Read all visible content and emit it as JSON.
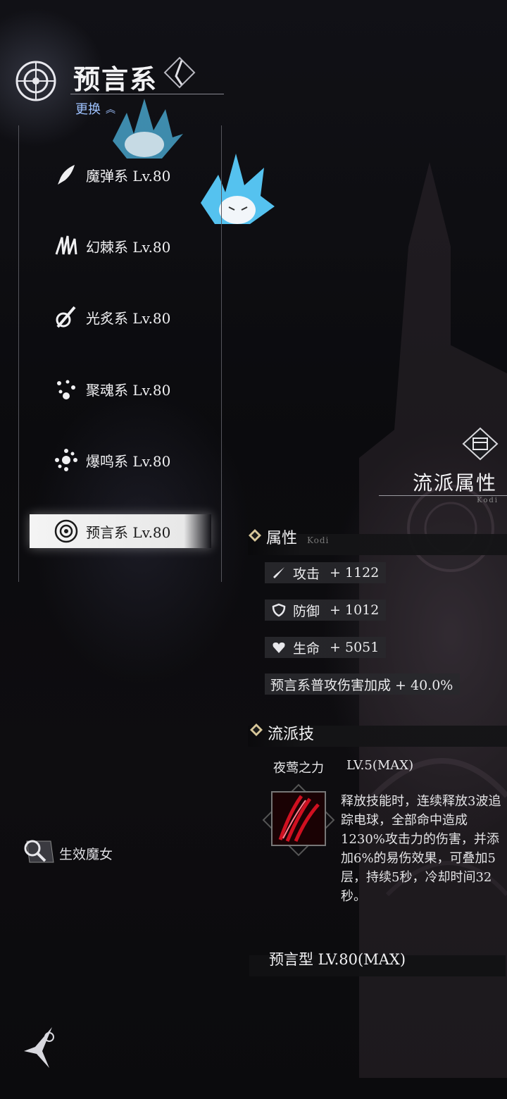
{
  "header": {
    "title": "预言系",
    "change_label": "更换",
    "change_icon": "double-chevron-up-icon"
  },
  "school_list": [
    {
      "label": "魔弹系 Lv.80",
      "icon": "magic-bullet-icon",
      "selected": false
    },
    {
      "label": "幻棘系 Lv.80",
      "icon": "thorn-icon",
      "selected": false
    },
    {
      "label": "光炙系 Lv.80",
      "icon": "light-blade-icon",
      "selected": false
    },
    {
      "label": "聚魂系 Lv.80",
      "icon": "soul-orbs-icon",
      "selected": false
    },
    {
      "label": "爆鸣系 Lv.80",
      "icon": "burst-orbs-icon",
      "selected": false
    },
    {
      "label": "预言系 Lv.80",
      "icon": "prophecy-sigil-icon",
      "selected": true
    }
  ],
  "panel": {
    "title": "流派属性",
    "subtitle": "Kodi",
    "attributes_header": "属性",
    "attributes_sub": "Kodi",
    "stats": [
      {
        "icon": "sword-icon",
        "name": "攻击",
        "value": "+ 1122"
      },
      {
        "icon": "shield-icon",
        "name": "防御",
        "value": "+ 1012"
      },
      {
        "icon": "heart-icon",
        "name": "生命",
        "value": "+ 5051"
      }
    ],
    "bonus": "预言系普攻伤害加成 + 40.0%",
    "skill_header": "流派技",
    "skill_name": "夜莺之力",
    "skill_level": "LV.5(MAX)",
    "skill_desc": "释放技能时，连续释放3波追踪电球，全部命中造成1230%攻击力的伤害，并添加6%的易伤效果，可叠加5层，持续5秒，冷却时间32秒。",
    "type_label": "预言型  LV.80(MAX)"
  },
  "effect_witch": "生效魔女",
  "colors": {
    "accent_link": "#9ec2ff",
    "diamond_gold": "#d8c79a",
    "skill_red": "#d01020"
  }
}
